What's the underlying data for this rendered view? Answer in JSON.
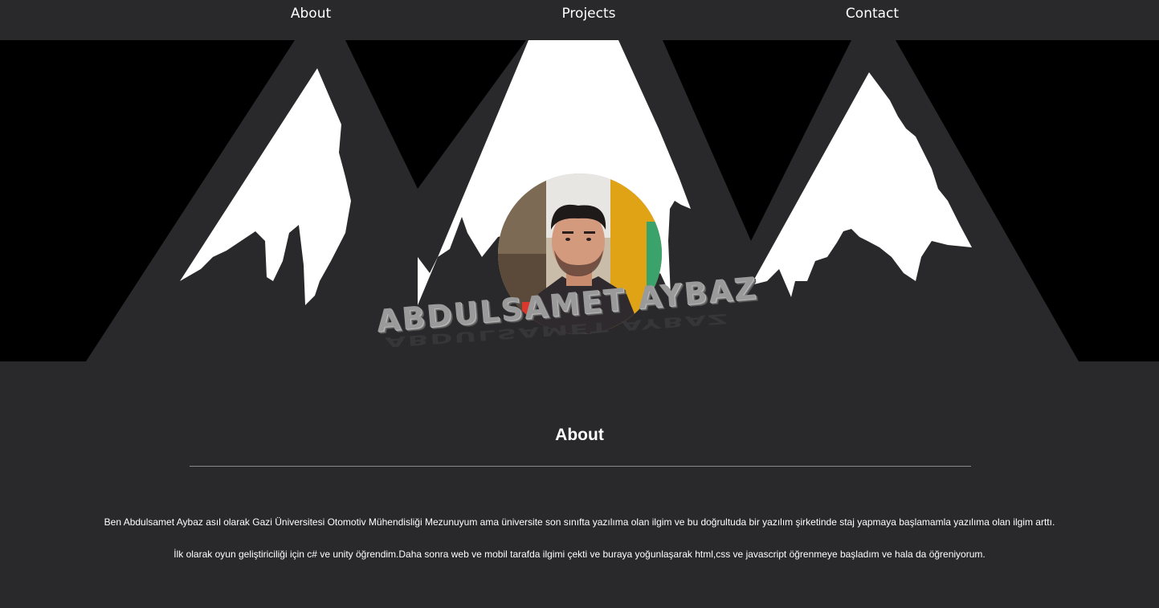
{
  "nav": {
    "items": [
      {
        "label": "About"
      },
      {
        "label": "Projects"
      },
      {
        "label": "Contact"
      }
    ]
  },
  "hero": {
    "name": "ABDULSAMET AYBAZ",
    "photo_alt": "Profile photo"
  },
  "about": {
    "title": "About",
    "paragraphs": [
      "Ben Abdulsamet Aybaz asıl olarak Gazi Üniversitesi Otomotiv Mühendisliği Mezunuyum ama üniversite son sınıfta yazılıma olan ilgim ve bu doğrultuda bir yazılım şirketinde staj yapmaya başlamamla yazılıma olan ilgim arttı.",
      "İlk olarak oyun geliştiriciliği için c# ve unity öğrendim.Daha sonra web ve mobil tarafda ilgimi çekti ve buraya yoğunlaşarak html,css ve javascript öğrenmeye başladım ve hala da öğreniyorum."
    ]
  },
  "colors": {
    "background": "#29292b",
    "hero_background": "#000000",
    "text": "#ffffff"
  }
}
